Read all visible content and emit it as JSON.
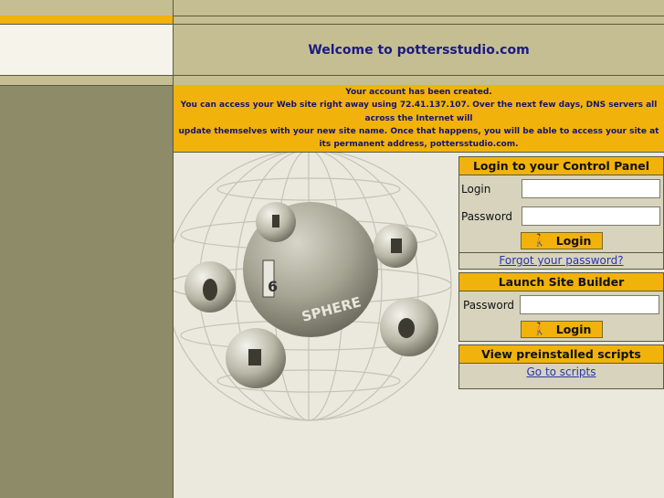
{
  "header": {
    "welcome": "Welcome to pottersstudio.com"
  },
  "notice": {
    "line1": "Your account has been created.",
    "line2": "You can access your Web site right away using 72.41.137.107. Over the next few days, DNS servers all across the Internet will",
    "line3": "update themselves with your new site name. Once that happens, you will be able to access your site at its permanent address, pottersstudio.com."
  },
  "logo": {
    "text": "SPHERE",
    "number": "6"
  },
  "control_panel": {
    "title": "Login to your Control Panel",
    "login_label": "Login",
    "password_label": "Password",
    "login_value": "",
    "password_value": "",
    "button": "Login",
    "forgot": "Forgot your password?"
  },
  "site_builder": {
    "title": "Launch Site Builder",
    "password_label": "Password",
    "password_value": "",
    "button": "Login"
  },
  "scripts": {
    "title": "View preinstalled scripts",
    "link": "Go to scripts"
  },
  "icons": {
    "walker": "walking-person-icon"
  },
  "colors": {
    "accent": "#f2b20c",
    "olive": "#8e8b69",
    "tan": "#c6be93",
    "link": "#2a35b0"
  }
}
